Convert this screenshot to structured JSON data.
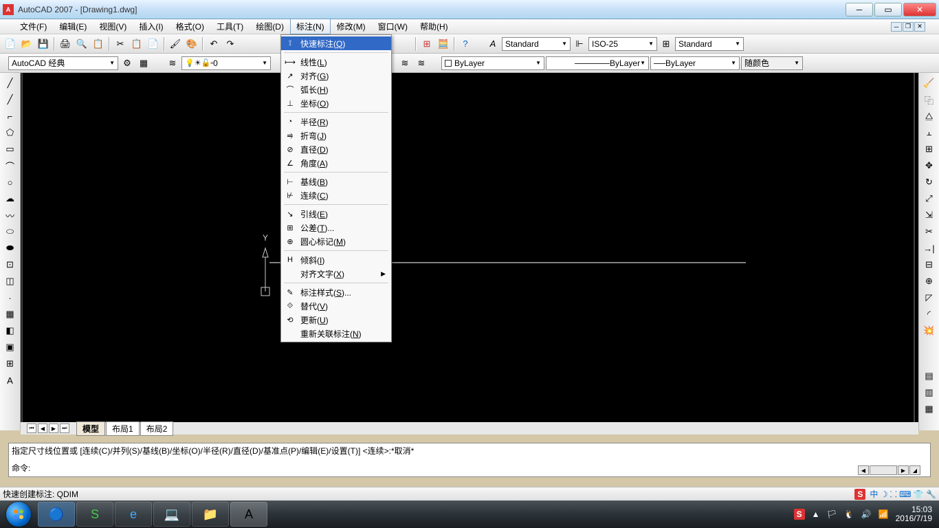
{
  "title": "AutoCAD 2007 - [Drawing1.dwg]",
  "menubar": {
    "items": [
      "文件(F)",
      "编辑(E)",
      "视图(V)",
      "插入(I)",
      "格式(O)",
      "工具(T)",
      "绘图(D)",
      "标注(N)",
      "修改(M)",
      "窗口(W)",
      "帮助(H)"
    ],
    "active_index": 7
  },
  "toolbar1": {
    "workspace": "AutoCAD 经典",
    "text_style": "Standard",
    "dim_style": "ISO-25",
    "table_style": "Standard"
  },
  "toolbar2": {
    "layer": "0",
    "bylayer1": "ByLayer",
    "bylayer2": "ByLayer",
    "bylayer3": "ByLayer",
    "color_label": "随颜色"
  },
  "tabs": {
    "model": "模型",
    "layout1": "布局1",
    "layout2": "布局2"
  },
  "command": {
    "line1": "指定尺寸线位置或 [连续(C)/并列(S)/基线(B)/坐标(O)/半径(R)/直径(D)/基准点(P)/编辑(E)/设置(T)] <连续>:*取消*",
    "line2": "命令:"
  },
  "statusbar": {
    "left": "快速创建标注:  QDIM",
    "ime": "S",
    "ime_text": "中 ☽ ⸬ ⌨ 👕 🔧"
  },
  "taskbar": {
    "time": "15:03",
    "date": "2016/7/19"
  },
  "dropdown": {
    "items": [
      {
        "icon": "⟟",
        "label": "快速标注(Q)",
        "hi": true
      },
      {
        "sep": true
      },
      {
        "icon": "⟼",
        "label": "线性(L)"
      },
      {
        "icon": "↗",
        "label": "对齐(G)"
      },
      {
        "icon": "⌒",
        "label": "弧长(H)"
      },
      {
        "icon": "⊥",
        "label": "坐标(O)"
      },
      {
        "sep": true
      },
      {
        "icon": "◔",
        "label": "半径(R)"
      },
      {
        "icon": "⥤",
        "label": "折弯(J)"
      },
      {
        "icon": "⊘",
        "label": "直径(D)"
      },
      {
        "icon": "∠",
        "label": "角度(A)"
      },
      {
        "sep": true
      },
      {
        "icon": "⊢",
        "label": "基线(B)"
      },
      {
        "icon": "⊬",
        "label": "连续(C)"
      },
      {
        "sep": true
      },
      {
        "icon": "↘",
        "label": "引线(E)"
      },
      {
        "icon": "⊞",
        "label": "公差(T)..."
      },
      {
        "icon": "⊕",
        "label": "圆心标记(M)"
      },
      {
        "sep": true
      },
      {
        "icon": "H",
        "label": "倾斜(I)"
      },
      {
        "icon": "",
        "label": "对齐文字(X)",
        "sub": true
      },
      {
        "sep": true
      },
      {
        "icon": "✎",
        "label": "标注样式(S)..."
      },
      {
        "icon": "⟐",
        "label": "替代(V)"
      },
      {
        "icon": "⟲",
        "label": "更新(U)"
      },
      {
        "icon": "",
        "label": "重新关联标注(N)"
      }
    ]
  }
}
